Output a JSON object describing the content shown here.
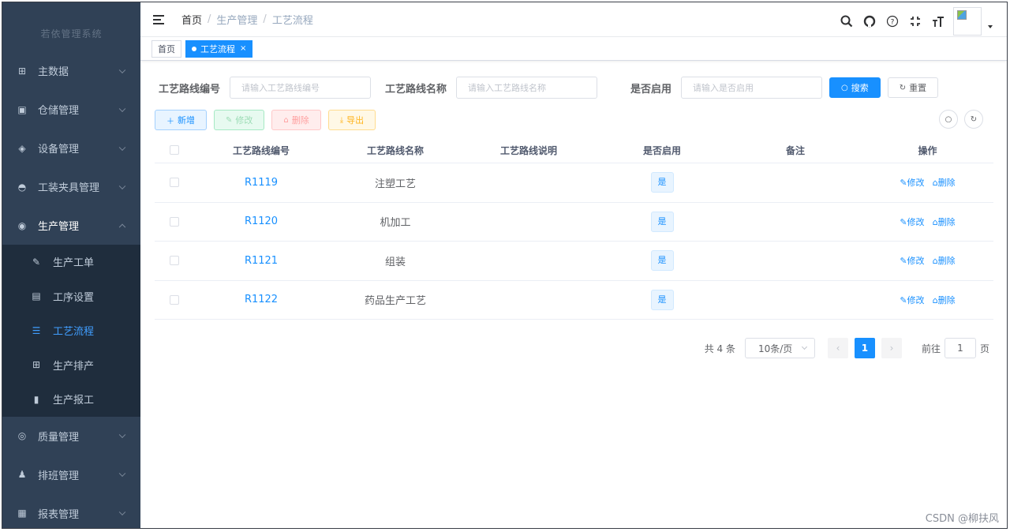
{
  "sidebar": {
    "logo_text": "若依管理系统",
    "items": [
      {
        "label": "主数据",
        "icon": "table-icon",
        "glyph": "⊞"
      },
      {
        "label": "仓储管理",
        "icon": "warehouse-icon",
        "glyph": "▣"
      },
      {
        "label": "设备管理",
        "icon": "device-icon",
        "glyph": "◈"
      },
      {
        "label": "工装夹具管理",
        "icon": "fixture-icon",
        "glyph": "◓"
      },
      {
        "label": "生产管理",
        "icon": "production-icon",
        "glyph": "◉"
      }
    ],
    "sub_items": [
      {
        "label": "生产工单",
        "icon": "edit-icon",
        "glyph": "✎"
      },
      {
        "label": "工序设置",
        "icon": "process-icon",
        "glyph": "▤"
      },
      {
        "label": "工艺流程",
        "icon": "list-icon",
        "glyph": "☰"
      },
      {
        "label": "生产排产",
        "icon": "grid-icon",
        "glyph": "⊞"
      },
      {
        "label": "生产报工",
        "icon": "bar-chart-icon",
        "glyph": "▮"
      }
    ],
    "bottom_items": [
      {
        "label": "质量管理",
        "icon": "quality-icon",
        "glyph": "◎"
      },
      {
        "label": "排班管理",
        "icon": "people-icon",
        "glyph": "♟"
      },
      {
        "label": "报表管理",
        "icon": "report-icon",
        "glyph": "▦"
      }
    ]
  },
  "header": {
    "breadcrumb": [
      "首页",
      "生产管理",
      "工艺流程"
    ],
    "breadcrumb_sep": "/"
  },
  "tags": {
    "home": "首页",
    "active": "工艺流程",
    "close": "×"
  },
  "search": {
    "route_code_label": "工艺路线编号",
    "route_code_placeholder": "请输入工艺路线编号",
    "route_name_label": "工艺路线名称",
    "route_name_placeholder": "请输入工艺路线名称",
    "enabled_label": "是否启用",
    "enabled_placeholder": "请输入是否启用",
    "search_button": "搜索",
    "reset_button": "重置"
  },
  "toolbar": {
    "add": "新增",
    "edit": "修改",
    "delete": "删除",
    "export": "导出"
  },
  "table": {
    "columns": [
      "工艺路线编号",
      "工艺路线名称",
      "工艺路线说明",
      "是否启用",
      "备注",
      "操作"
    ],
    "rows": [
      {
        "code": "R1119",
        "name": "注塑工艺",
        "desc": "",
        "enabled": "是",
        "remark": ""
      },
      {
        "code": "R1120",
        "name": "机加工",
        "desc": "",
        "enabled": "是",
        "remark": ""
      },
      {
        "code": "R1121",
        "name": "组装",
        "desc": "",
        "enabled": "是",
        "remark": ""
      },
      {
        "code": "R1122",
        "name": "药品生产工艺",
        "desc": "",
        "enabled": "是",
        "remark": ""
      }
    ],
    "op_edit": "修改",
    "op_delete": "删除"
  },
  "pagination": {
    "total": "共 4 条",
    "page_size": "10条/页",
    "current_page": "1",
    "goto_label": "前往",
    "goto_value": "1",
    "page_unit": "页"
  },
  "watermark": "CSDN @柳扶风",
  "colors": {
    "sidebar_bg": "#304156",
    "submenu_bg": "#1f2d3d",
    "primary": "#1890ff"
  }
}
